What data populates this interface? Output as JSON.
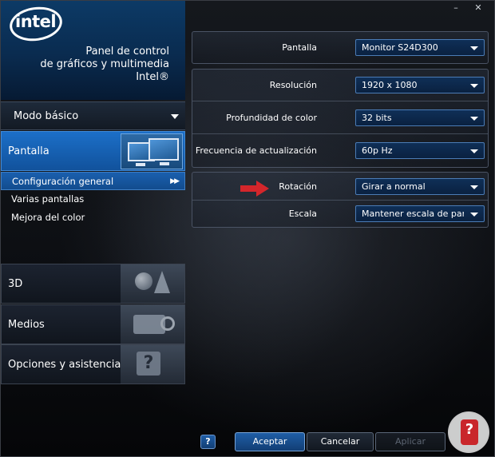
{
  "window": {
    "title": "Panel de control de gráficos y multimedia Intel®",
    "controls": {
      "minimize": "–",
      "close": "✕"
    }
  },
  "brand": {
    "logo_text": "intel",
    "title_lines": [
      "Panel de control",
      "de gráficos y multimedia",
      "Intel®"
    ]
  },
  "mode": {
    "label": "Modo básico"
  },
  "sidebar": {
    "categories": [
      {
        "label": "Pantalla",
        "icon": "monitors-icon",
        "active": true
      },
      {
        "label": "3D",
        "icon": "3d-shapes-icon"
      },
      {
        "label": "Medios",
        "icon": "video-camera-icon"
      },
      {
        "label": "Opciones y asistencia",
        "icon": "help-tools-icon"
      }
    ],
    "subitems": [
      {
        "label": "Configuración general",
        "active": true
      },
      {
        "label": "Varias pantallas"
      },
      {
        "label": "Mejora del color"
      }
    ]
  },
  "settings": {
    "pantalla": {
      "label": "Pantalla",
      "value": "Monitor S24D300"
    },
    "resolucion": {
      "label": "Resolución",
      "value": "1920 x 1080"
    },
    "profundidad": {
      "label": "Profundidad de color",
      "value": "32 bits"
    },
    "frecuencia": {
      "label": "Frecuencia de actualización",
      "value": "60p Hz"
    },
    "rotacion": {
      "label": "Rotación",
      "value": "Girar a normal"
    },
    "escala": {
      "label": "Escala",
      "value": "Mantener escala de pant..."
    }
  },
  "buttons": {
    "help": "?",
    "ok": "Aceptar",
    "cancel": "Cancelar",
    "apply": "Aplicar"
  },
  "colors": {
    "accent": "#1c6fc8",
    "arrow": "#d4262b"
  }
}
